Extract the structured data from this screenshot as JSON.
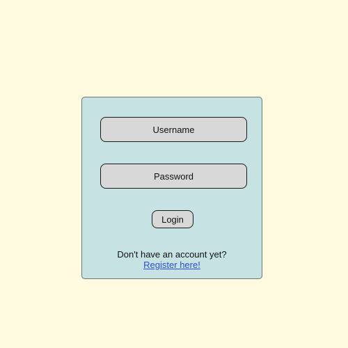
{
  "colors": {
    "page_background": "#fefbe0",
    "card_background": "#c6e2e2",
    "field_background": "#d8d8d8",
    "link": "#2a4fd6"
  },
  "login_form": {
    "username_label": "Username",
    "password_label": "Password",
    "login_label": "Login",
    "register_prompt": "Don't have an account yet?",
    "register_link": "Register here!"
  }
}
